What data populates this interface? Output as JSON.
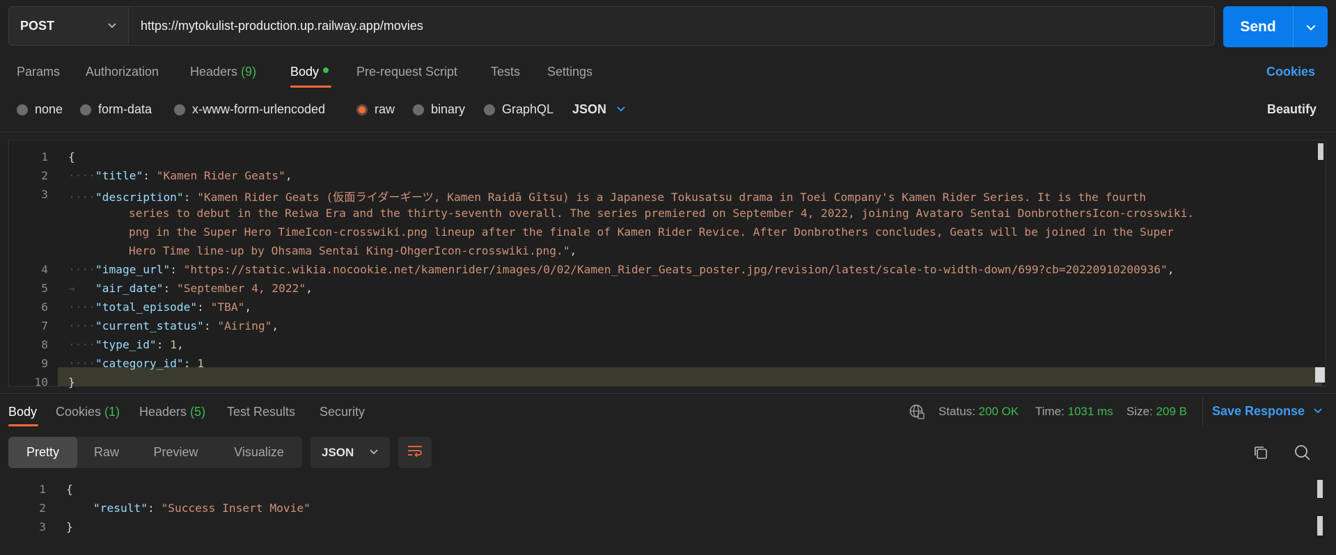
{
  "request": {
    "method": "POST",
    "url": "https://mytokulist-production.up.railway.app/movies",
    "send_label": "Send"
  },
  "request_tabs": {
    "params": "Params",
    "authorization": "Authorization",
    "headers": "Headers",
    "headers_count": "(9)",
    "body": "Body",
    "pre_request": "Pre-request Script",
    "tests": "Tests",
    "settings": "Settings",
    "cookies": "Cookies"
  },
  "body_types": {
    "none": "none",
    "form_data": "form-data",
    "urlencoded": "x-www-form-urlencoded",
    "raw": "raw",
    "binary": "binary",
    "graphql": "GraphQL",
    "format": "JSON",
    "beautify": "Beautify",
    "selected": "raw"
  },
  "editor": {
    "line_numbers": [
      "1",
      "2",
      "3",
      "4",
      "5",
      "6",
      "7",
      "8",
      "9",
      "10"
    ],
    "title_key": "\"title\"",
    "title_val": "\"Kamen Rider Geats\"",
    "desc_key": "\"description\"",
    "desc_l1": "\"Kamen Rider Geats (仮面ライダーギーツ, Kamen Raidā Gītsu) is a Japanese Tokusatsu drama in Toei Company's Kamen Rider Series. It is the fourth",
    "desc_l2": "series to debut in the Reiwa Era and the thirty-seventh overall. The series premiered on September 4, 2022, joining Avataro Sentai DonbrothersIcon-crosswiki.",
    "desc_l3": "png in the Super Hero TimeIcon-crosswiki.png lineup after the finale of Kamen Rider Revice. After Donbrothers concludes, Geats will be joined in the Super",
    "desc_l4": "Hero Time line-up by Ohsama Sentai King-OhgerIcon-crosswiki.png.\"",
    "image_key": "\"image_url\"",
    "image_val": "\"https://static.wikia.nocookie.net/kamenrider/images/0/02/Kamen_Rider_Geats_poster.jpg/revision/latest/scale-to-width-down/699?cb=20220910200936\"",
    "air_key": "\"air_date\"",
    "air_val": "\"September 4, 2022\"",
    "total_key": "\"total_episode\"",
    "total_val": "\"TBA\"",
    "status_key": "\"current_status\"",
    "status_val": "\"Airing\"",
    "type_key": "\"type_id\"",
    "type_val": "1",
    "cat_key": "\"category_id\"",
    "cat_val": "1"
  },
  "response_tabs": {
    "body": "Body",
    "cookies": "Cookies",
    "cookies_count": "(1)",
    "headers": "Headers",
    "headers_count": "(5)",
    "test_results": "Test Results",
    "security": "Security"
  },
  "response_status": {
    "status_label": "Status:",
    "status_value": "200 OK",
    "time_label": "Time:",
    "time_value": "1031 ms",
    "size_label": "Size:",
    "size_value": "209 B",
    "save_response": "Save Response"
  },
  "response_view": {
    "pretty": "Pretty",
    "raw": "Raw",
    "preview": "Preview",
    "visualize": "Visualize",
    "format": "JSON"
  },
  "response_body": {
    "line_numbers": [
      "1",
      "2",
      "3"
    ],
    "result_key": "\"result\"",
    "result_val": "\"Success Insert Movie\""
  }
}
